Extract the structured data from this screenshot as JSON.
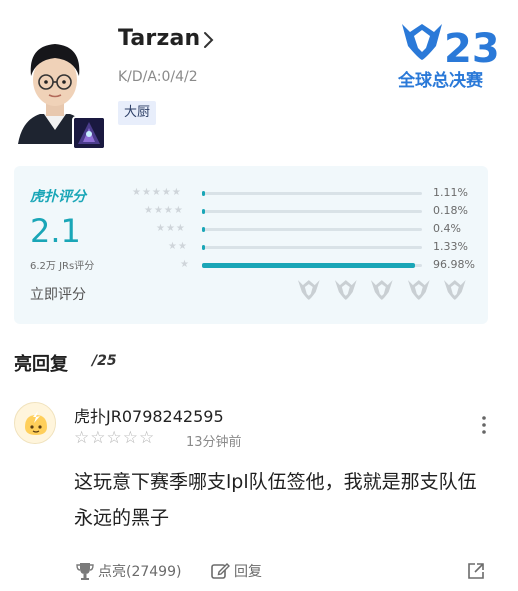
{
  "player": {
    "name": "Tarzan",
    "kda": "K/D/A:0/4/2",
    "tag": "大厨",
    "event_logo_text": "全球总决赛",
    "event_logo_number": "23"
  },
  "rating": {
    "brand": "虎扑评分",
    "score": "2.1",
    "count": "6.2万 JRs评分",
    "rate_now": "立即评分",
    "distribution": [
      {
        "stars": 5,
        "percent": 1.11,
        "label": "1.11%"
      },
      {
        "stars": 4,
        "percent": 0.18,
        "label": "0.18%"
      },
      {
        "stars": 3,
        "percent": 0.4,
        "label": "0.4%"
      },
      {
        "stars": 2,
        "percent": 1.33,
        "label": "1.33%"
      },
      {
        "stars": 1,
        "percent": 96.98,
        "label": "96.98%"
      }
    ],
    "emblem_count": 5
  },
  "comments_section": {
    "title": "亮回复",
    "count": "/25"
  },
  "comment": {
    "user": "虎扑JR0798242595",
    "stars_given": 0,
    "stars_total": 5,
    "time": "13分钟前",
    "text": "这玩意下赛季哪支lpl队伍签他，我就是那支队伍永远的黑子",
    "like_label": "点亮(27499)",
    "reply_label": "回复"
  },
  "colors": {
    "accent": "#1aa6b7",
    "card_bg": "#f1f8fb",
    "logo_blue": "#2a79d8"
  }
}
